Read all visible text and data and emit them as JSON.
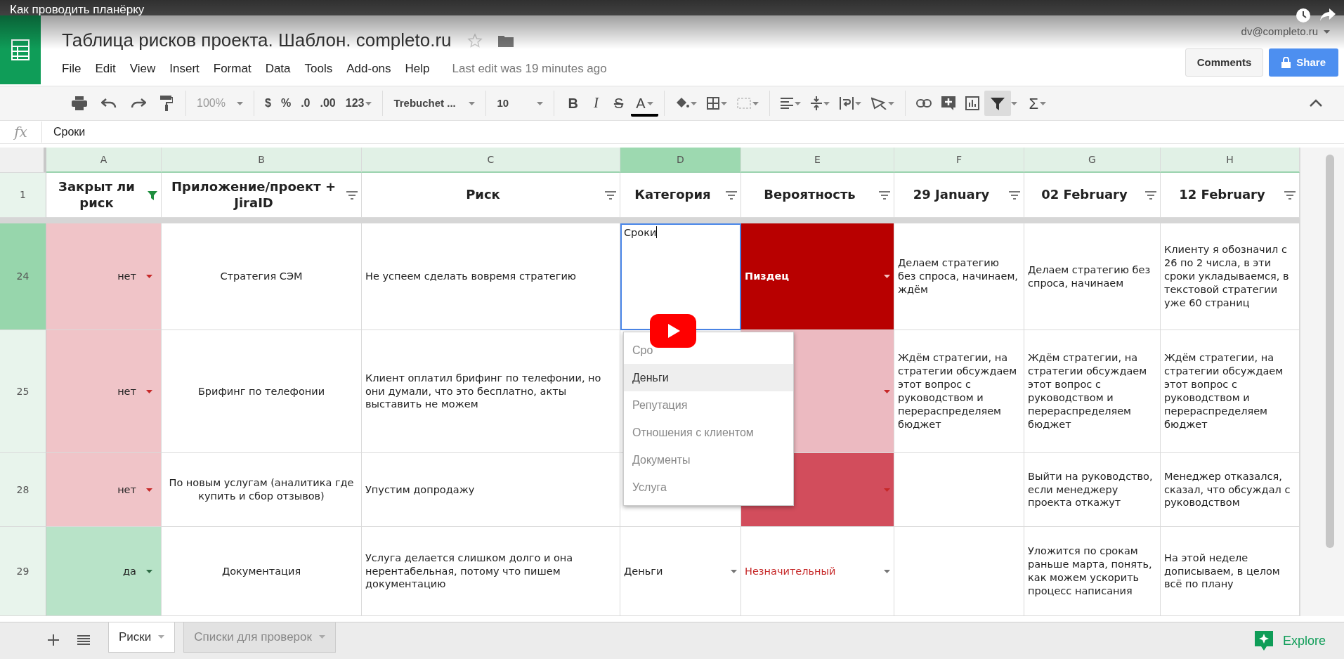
{
  "video": {
    "title": "Как проводить планёрку"
  },
  "document": {
    "title": "Таблица рисков проекта. Шаблон. completo.ru",
    "account": "dv@completo.ru",
    "last_edit": "Last edit was 19 minutes ago"
  },
  "menu": [
    "File",
    "Edit",
    "View",
    "Insert",
    "Format",
    "Data",
    "Tools",
    "Add-ons",
    "Help"
  ],
  "buttons": {
    "comments": "Comments",
    "share": "Share"
  },
  "toolbar": {
    "zoom": "100%",
    "currency": "$",
    "percent": "%",
    "decrease_decimals": ".0",
    "increase_decimals": ".00",
    "number_format": "123",
    "font": "Trebuchet ...",
    "font_size": "10",
    "bold": "B",
    "italic": "I",
    "strikethrough": "S",
    "text_color": "A",
    "functions": "Σ",
    "filter_active": true
  },
  "formula_bar": {
    "label": "fx",
    "value": "Сроки"
  },
  "columns": [
    {
      "label": "A",
      "selected": false
    },
    {
      "label": "B",
      "selected": false
    },
    {
      "label": "C",
      "selected": false
    },
    {
      "label": "D",
      "selected": true
    },
    {
      "label": "E",
      "selected": false
    },
    {
      "label": "F",
      "selected": false
    },
    {
      "label": "G",
      "selected": false
    },
    {
      "label": "H",
      "selected": false
    }
  ],
  "header_row": {
    "number": "1",
    "cells": [
      {
        "text": "Закрыт ли риск",
        "filtered": true
      },
      {
        "text": "Приложение/проект + JiraID",
        "filtered": false
      },
      {
        "text": "Риск",
        "filtered": false
      },
      {
        "text": "Категория",
        "filtered": false
      },
      {
        "text": "Вероятность",
        "filtered": false
      },
      {
        "text": "29 January",
        "filtered": false
      },
      {
        "text": "02 February",
        "filtered": false
      },
      {
        "text": "12 February",
        "filtered": false
      }
    ]
  },
  "rows": [
    {
      "number": "24",
      "selected": true,
      "cells": [
        {
          "text": "нет",
          "color": "#f0c4c8",
          "dropdown": true
        },
        {
          "text": "Стратегия СЭМ"
        },
        {
          "text": "Не успеем сделать вовремя стратегию"
        },
        {
          "text": "Сроки",
          "editing": true
        },
        {
          "text": "Пиздец",
          "color": "#b80000",
          "kind": "alert",
          "dropdown": true
        },
        {
          "text": "Делаем стратегию без спроса, начинаем, ждём"
        },
        {
          "text": "Делаем стратегию без спроса, начинаем"
        },
        {
          "text": "Клиенту я обозначил с 26 по 2 числа, в эти сроки укладываемся, в текстовой стратегии уже 60 страниц"
        }
      ]
    },
    {
      "number": "25",
      "selected": false,
      "cells": [
        {
          "text": "нет",
          "color": "#f0c4c8",
          "dropdown": true
        },
        {
          "text": "Брифинг по телефонии"
        },
        {
          "text": "Клиент оплатил брифинг по телефонии, но они думали, что это бесплатно, акты выставить не можем"
        },
        {},
        {
          "color": "#ecbac1",
          "dropdown": true
        },
        {
          "text": "Ждём стратегии, на стратегии обсуждаем этот вопрос с руководством и перераспределяем бюджет"
        },
        {
          "text": "Ждём стратегии, на стратегии обсуждаем этот вопрос с руководством и перераспределяем бюджет"
        },
        {
          "text": "Ждём стратегии, на стратегии обсуждаем этот вопрос с руководством и перераспределяем бюджет"
        }
      ]
    },
    {
      "number": "28",
      "selected": false,
      "cells": [
        {
          "text": "нет",
          "color": "#f0c4c8",
          "dropdown": true
        },
        {
          "text": "По новым услугам (аналитика где купить и сбор отзывов)"
        },
        {
          "text": "Упустим допродажу"
        },
        {},
        {
          "color": "#d24d5c",
          "dropdown": true
        },
        {},
        {
          "text": "Выйти на руководство, если менеджеру проекта откажут"
        },
        {
          "text": "Менеджер отказался,  сказал, что обсуждал с руководством"
        }
      ]
    },
    {
      "number": "29",
      "selected": false,
      "cells": [
        {
          "text": "да",
          "color": "#b8e3c8",
          "dropdown": true
        },
        {
          "text": "Документация"
        },
        {
          "text": "Услуга делается слишком долго и она нерентабельная, потому что пишем документацию"
        },
        {
          "text": "Деньги",
          "dropdown": true
        },
        {
          "text": "Незначительный",
          "kind": "warning",
          "dropdown": true
        },
        {},
        {
          "text": "Уложится по срокам раньше марта, понять, как можем ускорить процесс написания"
        },
        {
          "text": "На этой неделе дописываем, в целом всё по плану"
        }
      ]
    }
  ],
  "dropdown_menu": [
    {
      "label": "Сро",
      "selected": false
    },
    {
      "label": "Деньги",
      "selected": true
    },
    {
      "label": "Репутация",
      "selected": false
    },
    {
      "label": "Отношения с клиентом",
      "selected": false
    },
    {
      "label": "Документы",
      "selected": false
    },
    {
      "label": "Услуга",
      "selected": false
    }
  ],
  "sheet_tabs": [
    {
      "label": "Риски",
      "selected": true
    },
    {
      "label": "Списки для проверок",
      "selected": false
    }
  ],
  "explore": {
    "label": "Explore"
  }
}
